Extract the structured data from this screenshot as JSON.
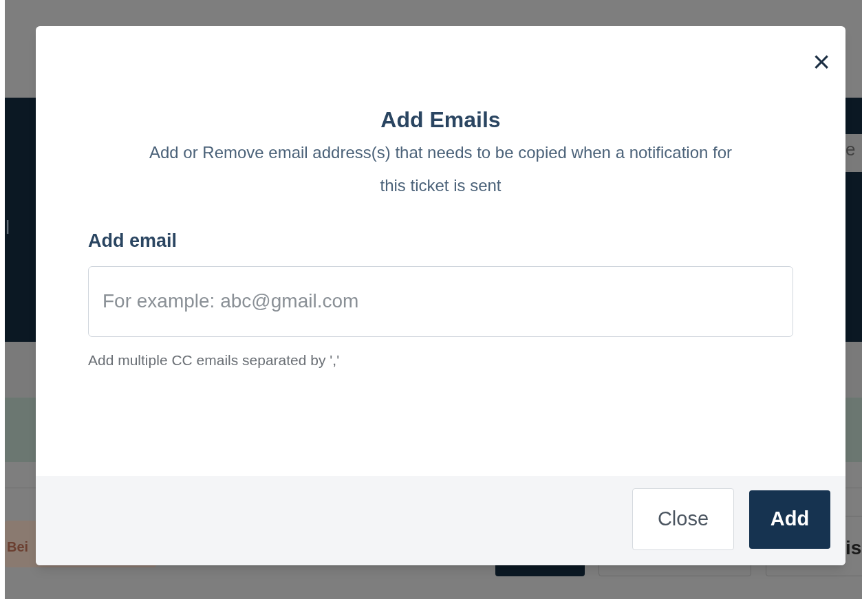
{
  "background": {
    "texts": [
      "l",
      "e",
      "Bei",
      "is"
    ]
  },
  "modal": {
    "title": "Add Emails",
    "description": "Add or Remove email address(s) that needs to be copied when a notification for this ticket is sent",
    "close_icon": "×",
    "field": {
      "label": "Add email",
      "placeholder": "For example: abc@gmail.com",
      "hint": "Add multiple CC emails separated by ','"
    },
    "buttons": [
      {
        "label": "Close",
        "kind": "secondary"
      },
      {
        "label": "Add",
        "kind": "primary"
      }
    ]
  }
}
